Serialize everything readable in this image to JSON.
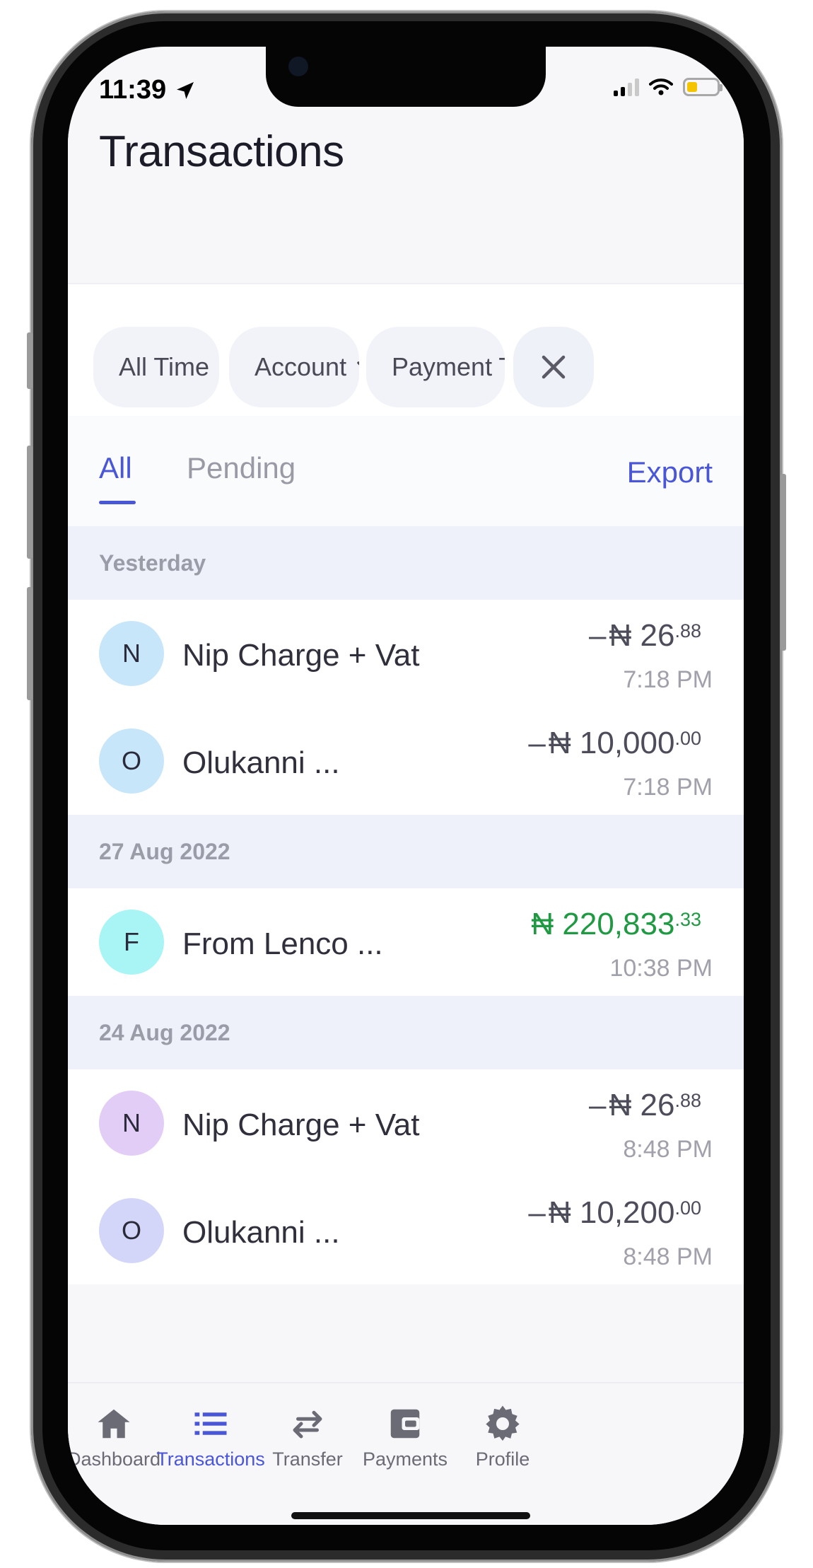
{
  "status_bar": {
    "time": "11:39",
    "icons": [
      "location-arrow-icon",
      "signal-icon",
      "wifi-icon",
      "battery-icon"
    ]
  },
  "header": {
    "title": "Transactions"
  },
  "filters": [
    {
      "label": "All Time",
      "icon": "chevron-down-icon"
    },
    {
      "label": "Account",
      "icon": "chevron-down-icon"
    },
    {
      "label": "Payment T",
      "icon": "chevron-down-icon"
    }
  ],
  "tabs": {
    "items": [
      {
        "label": "All",
        "active": true
      },
      {
        "label": "Pending",
        "active": false
      }
    ],
    "export_label": "Export"
  },
  "groups": [
    {
      "date": "Yesterday",
      "transactions": [
        {
          "initial": "N",
          "name": "Nip Charge + Vat",
          "sign": "–",
          "currency": "₦",
          "amount": "26",
          "cents": ".88",
          "time": "7:18 PM",
          "avatar_color": "#c7e6fa",
          "type": "debit"
        },
        {
          "initial": "O",
          "name": "Olukanni ...",
          "sign": "–",
          "currency": "₦",
          "amount": "10,000",
          "cents": ".00",
          "time": "7:18 PM",
          "avatar_color": "#c7e6fa",
          "type": "debit"
        }
      ]
    },
    {
      "date": "27 Aug 2022",
      "transactions": [
        {
          "initial": "F",
          "name": "From Lenco ...",
          "sign": "",
          "currency": "₦",
          "amount": "220,833",
          "cents": ".33",
          "time": "10:38 PM",
          "avatar_color": "#a9f5f5",
          "type": "credit"
        }
      ]
    },
    {
      "date": "24 Aug 2022",
      "transactions": [
        {
          "initial": "N",
          "name": "Nip Charge + Vat",
          "sign": "–",
          "currency": "₦",
          "amount": "26",
          "cents": ".88",
          "time": "8:48 PM",
          "avatar_color": "#e2cdf7",
          "type": "debit"
        },
        {
          "initial": "O",
          "name": "Olukanni ...",
          "sign": "–",
          "currency": "₦",
          "amount": "10,200",
          "cents": ".00",
          "time": "8:48 PM",
          "avatar_color": "#d3d6f8",
          "type": "debit"
        }
      ]
    }
  ],
  "tabbar": [
    {
      "label": "Dashboard",
      "icon": "home-icon",
      "active": false
    },
    {
      "label": "Transactions",
      "icon": "list-icon",
      "active": true
    },
    {
      "label": "Transfer",
      "icon": "transfer-arrows-icon",
      "active": false
    },
    {
      "label": "Payments",
      "icon": "wallet-icon",
      "active": false
    },
    {
      "label": "Profile",
      "icon": "gear-icon",
      "active": false
    }
  ],
  "colors": {
    "accent": "#4a56d8",
    "credit": "#1f9a43",
    "debit_text": "#4c4c5a",
    "date_header_bg": "#eef1f9"
  }
}
